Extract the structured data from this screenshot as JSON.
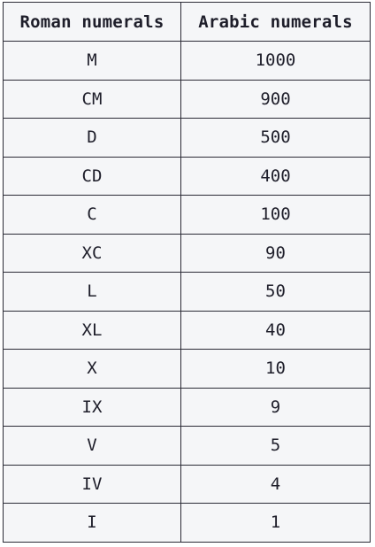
{
  "table": {
    "headers": [
      "Roman numerals",
      "Arabic numerals"
    ],
    "rows": [
      [
        "M",
        "1000"
      ],
      [
        "CM",
        "900"
      ],
      [
        "D",
        "500"
      ],
      [
        "CD",
        "400"
      ],
      [
        "C",
        "100"
      ],
      [
        "XC",
        "90"
      ],
      [
        "L",
        "50"
      ],
      [
        "XL",
        "40"
      ],
      [
        "X",
        "10"
      ],
      [
        "IX",
        "9"
      ],
      [
        "V",
        "5"
      ],
      [
        "IV",
        "4"
      ],
      [
        "I",
        "1"
      ]
    ]
  }
}
